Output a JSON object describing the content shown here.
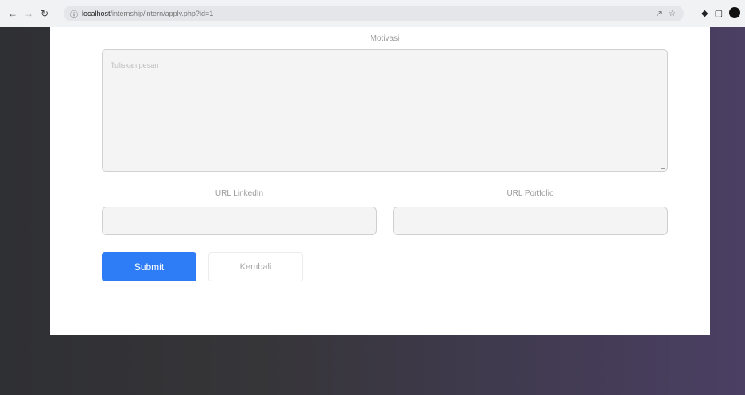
{
  "browser": {
    "url_host": "localhost",
    "url_path": "/internship/intern/apply.php?id=1",
    "back_icon": "arrow-left",
    "forward_icon": "arrow-right",
    "reload_icon": "reload"
  },
  "form": {
    "message_label": "Motivasi",
    "message_placeholder": "Tuliskan pesan",
    "linkedin_label": "URL LinkedIn",
    "linkedin_value": "",
    "portfolio_label": "URL Portfolio",
    "portfolio_value": "",
    "submit_label": "Submit",
    "cancel_label": "Kembali"
  },
  "colors": {
    "submit_bg": "#2f7df6",
    "card_bg": "#ffffff",
    "field_bg": "#f4f4f4"
  }
}
